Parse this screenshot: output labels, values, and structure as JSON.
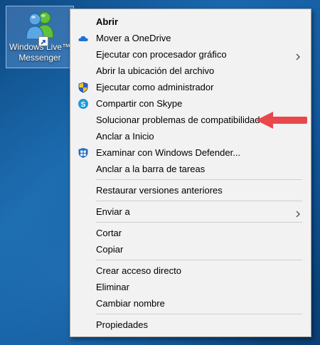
{
  "desktop": {
    "icon_label_line1": "Windows Live™",
    "icon_label_line2": "Messenger"
  },
  "menu": {
    "items": [
      {
        "label": "Abrir",
        "bold": true,
        "icon": "none"
      },
      {
        "label": "Mover a OneDrive",
        "icon": "onedrive-cloud-icon"
      },
      {
        "label": "Ejecutar con procesador gráfico",
        "icon": "none",
        "submenu": true
      },
      {
        "label": "Abrir la ubicación del archivo",
        "icon": "none"
      },
      {
        "label": "Ejecutar como administrador",
        "icon": "uac-shield-icon"
      },
      {
        "label": "Compartir con Skype",
        "icon": "skype-icon"
      },
      {
        "label": "Solucionar problemas de compatibilidad",
        "icon": "none"
      },
      {
        "label": "Anclar a Inicio",
        "icon": "none"
      },
      {
        "label": "Examinar con Windows Defender...",
        "icon": "windows-defender-icon"
      },
      {
        "label": "Anclar a la barra de tareas",
        "icon": "none"
      },
      {
        "label": "Restaurar versiones anteriores",
        "icon": "none"
      },
      {
        "label": "Enviar a",
        "icon": "none",
        "submenu": true
      },
      {
        "label": "Cortar",
        "icon": "none"
      },
      {
        "label": "Copiar",
        "icon": "none"
      },
      {
        "label": "Crear acceso directo",
        "icon": "none"
      },
      {
        "label": "Eliminar",
        "icon": "none"
      },
      {
        "label": "Cambiar nombre",
        "icon": "none"
      },
      {
        "label": "Propiedades",
        "icon": "none"
      }
    ]
  },
  "colors": {
    "annotation_arrow": "#e8474c",
    "onedrive": "#1a73d9",
    "skype": "#1d9bd7",
    "defender": "#1e6fc0"
  }
}
